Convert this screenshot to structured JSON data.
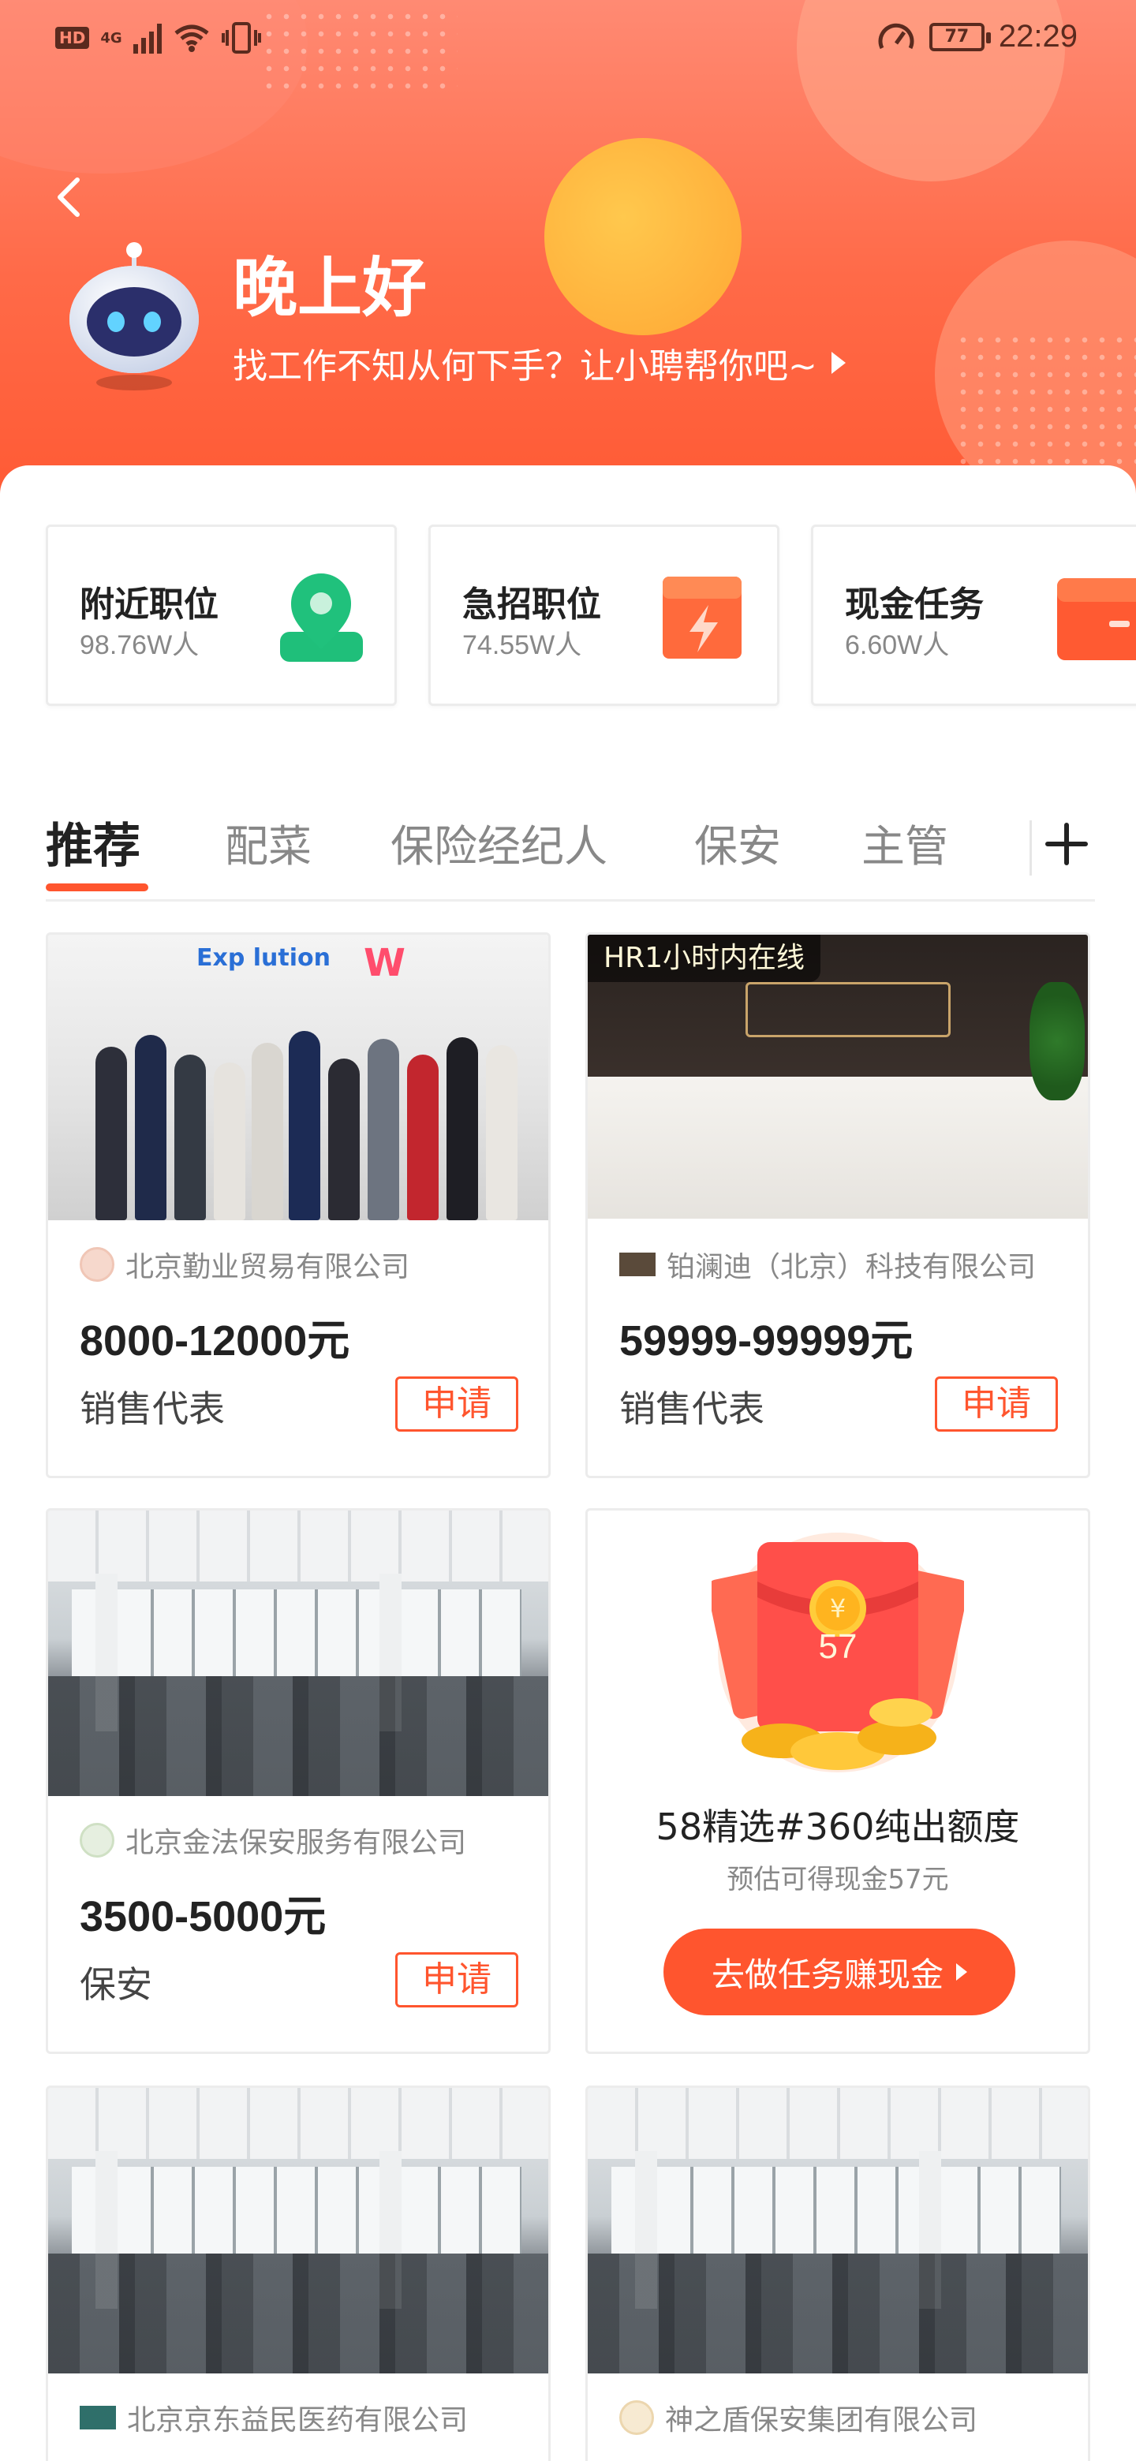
{
  "status_bar": {
    "hd": "HD",
    "network": "4G",
    "battery": "77",
    "time": "22:29"
  },
  "header": {
    "greeting": "晚上好",
    "subtitle": "找工作不知从何下手？让小聘帮你吧~"
  },
  "quick_cards": [
    {
      "title": "附近职位",
      "count": "98.76W人",
      "icon": "location-pin-icon",
      "color": "#1fbf7a"
    },
    {
      "title": "急招职位",
      "count": "74.55W人",
      "icon": "lightning-icon",
      "color": "#ff552e"
    },
    {
      "title": "现金任务",
      "count": "6.60W人",
      "icon": "wallet-icon",
      "color": "#ff552e"
    }
  ],
  "tabs": [
    "推荐",
    "配菜",
    "保险经纪人",
    "保安",
    "主管"
  ],
  "jobs": [
    {
      "company": "北京勤业贸易有限公司",
      "salary": "8000-12000元",
      "position": "销售代表",
      "apply": "申请"
    },
    {
      "company": "铂澜迪（北京）科技有限公司",
      "salary": "59999-99999元",
      "position": "销售代表",
      "apply": "申请",
      "badge": "HR1小时内在线"
    },
    {
      "company": "北京金法保安服务有限公司",
      "salary": "3500-5000元",
      "position": "保安",
      "apply": "申请"
    },
    {
      "company": "北京京东益民医药有限公司"
    },
    {
      "company": "神之盾保安集团有限公司"
    }
  ],
  "task_card": {
    "amount": "57",
    "title": "58精选#360纯出额度",
    "subtitle": "预估可得现金57元",
    "button": "去做任务赚现金"
  },
  "colors": {
    "accent": "#ff552e",
    "header_top": "#ff8a73",
    "header_bottom": "#ff5a34"
  }
}
